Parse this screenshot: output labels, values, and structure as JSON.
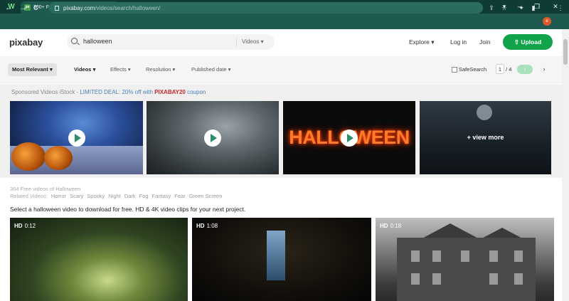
{
  "browser": {
    "tab_title": "300+ Free Halloween & Horror V",
    "tab_favicon": "px",
    "url_host": "pixabay.com",
    "url_path": "/videos/search/halloween/",
    "profile_initial": "e"
  },
  "header": {
    "logo": "pixabay",
    "search_query": "halloween",
    "search_type": "Videos",
    "explore": "Explore",
    "login": "Log in",
    "join": "Join",
    "upload": "Upload"
  },
  "filters": {
    "sort": "Most Relevant",
    "items": [
      "Videos",
      "Effects",
      "Resolution",
      "Published date"
    ],
    "safesearch": "SafeSearch",
    "page_current": "1",
    "page_total": "/ 4"
  },
  "sponsored": {
    "prefix": "Sponsored Videos iStock - ",
    "deal": "LIMITED DEAL: 20% off with ",
    "code": "PIXABAY20",
    "suffix": " coupon",
    "thumb3_text": "HALLOWEEN",
    "view_more": "+ view more"
  },
  "results": {
    "count_text": "364 Free videos of Halloween",
    "related_label": "Related Videos:",
    "related": [
      "Horror",
      "Scary",
      "Spooky",
      "Night",
      "Dark",
      "Fog",
      "Fantasy",
      "Fear",
      "Green Screen"
    ],
    "intro": "Select a halloween video to download for free. HD & 4K video clips for your next project.",
    "items": [
      {
        "quality": "HD",
        "duration": "0:12"
      },
      {
        "quality": "HD",
        "duration": "1:08"
      },
      {
        "quality": "HD",
        "duration": "0:18"
      }
    ]
  },
  "icons": {
    "window_logo": "W",
    "back": "←",
    "forward": "→",
    "reload": "C",
    "minimize": "–",
    "maximize": "❐",
    "close": "✕",
    "new_tab": "+",
    "tab_close": "×",
    "chevron_down": "▾",
    "prev": "‹",
    "next": "›",
    "upload_arrow": "⇧"
  }
}
